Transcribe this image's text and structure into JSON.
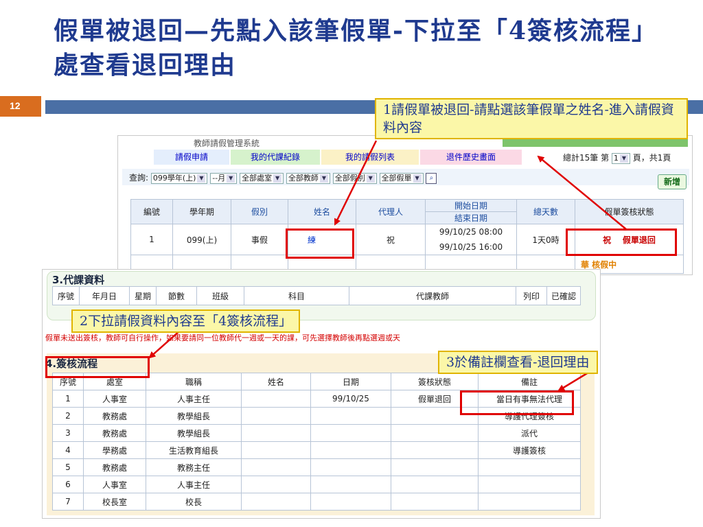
{
  "slide": {
    "title": "假單被退回—先點入該筆假單-下拉至「4簽核流程」處查看退回理由",
    "number": "12"
  },
  "callouts": {
    "c1": "1請假單被退回-請點選該筆假單之姓名-進入請假資料內容",
    "c2": "2下拉請假資料內容至「4簽核流程」",
    "c3": "3於備註欄查看-退回理由"
  },
  "shot1": {
    "header_fragment": "教師請假管理系統",
    "tabs": [
      "請假申請",
      "我的代課紀錄",
      "我的請假列表",
      "退件歷史畫面"
    ],
    "totals": {
      "prefix": "總計15筆  第",
      "page": "1",
      "suffix": "頁，共1頁"
    },
    "filter": {
      "label": "查詢:",
      "semester": "099學年(上)",
      "month": "--月",
      "office": "全部處室",
      "teacher": "全部教師",
      "leave_type": "全部假別",
      "status": "全部假單"
    },
    "add_button": "新增",
    "columns": [
      "編號",
      "學年期",
      "假別",
      "姓名",
      "代理人",
      "開始日期",
      "結束日期",
      "總天數",
      "假單簽核狀態"
    ],
    "rows": [
      {
        "no": "1",
        "term": "099(上)",
        "type": "事假",
        "name": "練",
        "agent": "祝",
        "start": "99/10/25  08:00",
        "end": "99/10/25  16:00",
        "days": "1天0時",
        "status_person": "祝",
        "status": "假單退回"
      }
    ],
    "next_row_status": "華 核假中"
  },
  "shot2": {
    "section3_title": "3.代課資料",
    "section3_columns": [
      "序號",
      "年月日",
      "星期",
      "節數",
      "班級",
      "科目",
      "代課教師",
      "列印",
      "已確認"
    ],
    "warning": "假單未送出簽核，教師可自行操作，如果要請同一位教師代一週或一天的課，可先選擇教師後再點選週或天",
    "section4_title": "4.簽核流程",
    "section4_columns": [
      "序號",
      "處室",
      "職稱",
      "姓名",
      "日期",
      "簽核狀態",
      "備註"
    ],
    "section4_rows": [
      {
        "seq": "1",
        "office": "人事室",
        "title": "人事主任",
        "name": "",
        "date": "99/10/25",
        "status": "假單退回",
        "note": "當日有事無法代理"
      },
      {
        "seq": "2",
        "office": "教務處",
        "title": "教學組長",
        "name": "",
        "date": "",
        "status": "",
        "note": "導護代理簽核"
      },
      {
        "seq": "3",
        "office": "教務處",
        "title": "教學組長",
        "name": "",
        "date": "",
        "status": "",
        "note": "派代"
      },
      {
        "seq": "4",
        "office": "學務處",
        "title": "生活教育組長",
        "name": "",
        "date": "",
        "status": "",
        "note": "導護簽核"
      },
      {
        "seq": "5",
        "office": "教務處",
        "title": "教務主任",
        "name": "",
        "date": "",
        "status": "",
        "note": ""
      },
      {
        "seq": "6",
        "office": "人事室",
        "title": "人事主任",
        "name": "",
        "date": "",
        "status": "",
        "note": ""
      },
      {
        "seq": "7",
        "office": "校長室",
        "title": "校長",
        "name": "",
        "date": "",
        "status": "",
        "note": ""
      }
    ]
  },
  "colors": {
    "title": "#1f3a8f",
    "accent_bar": "#4a6fa5",
    "number_box": "#d96d1f",
    "highlight": "#e00000",
    "callout_fill": "#fbf7a8"
  }
}
